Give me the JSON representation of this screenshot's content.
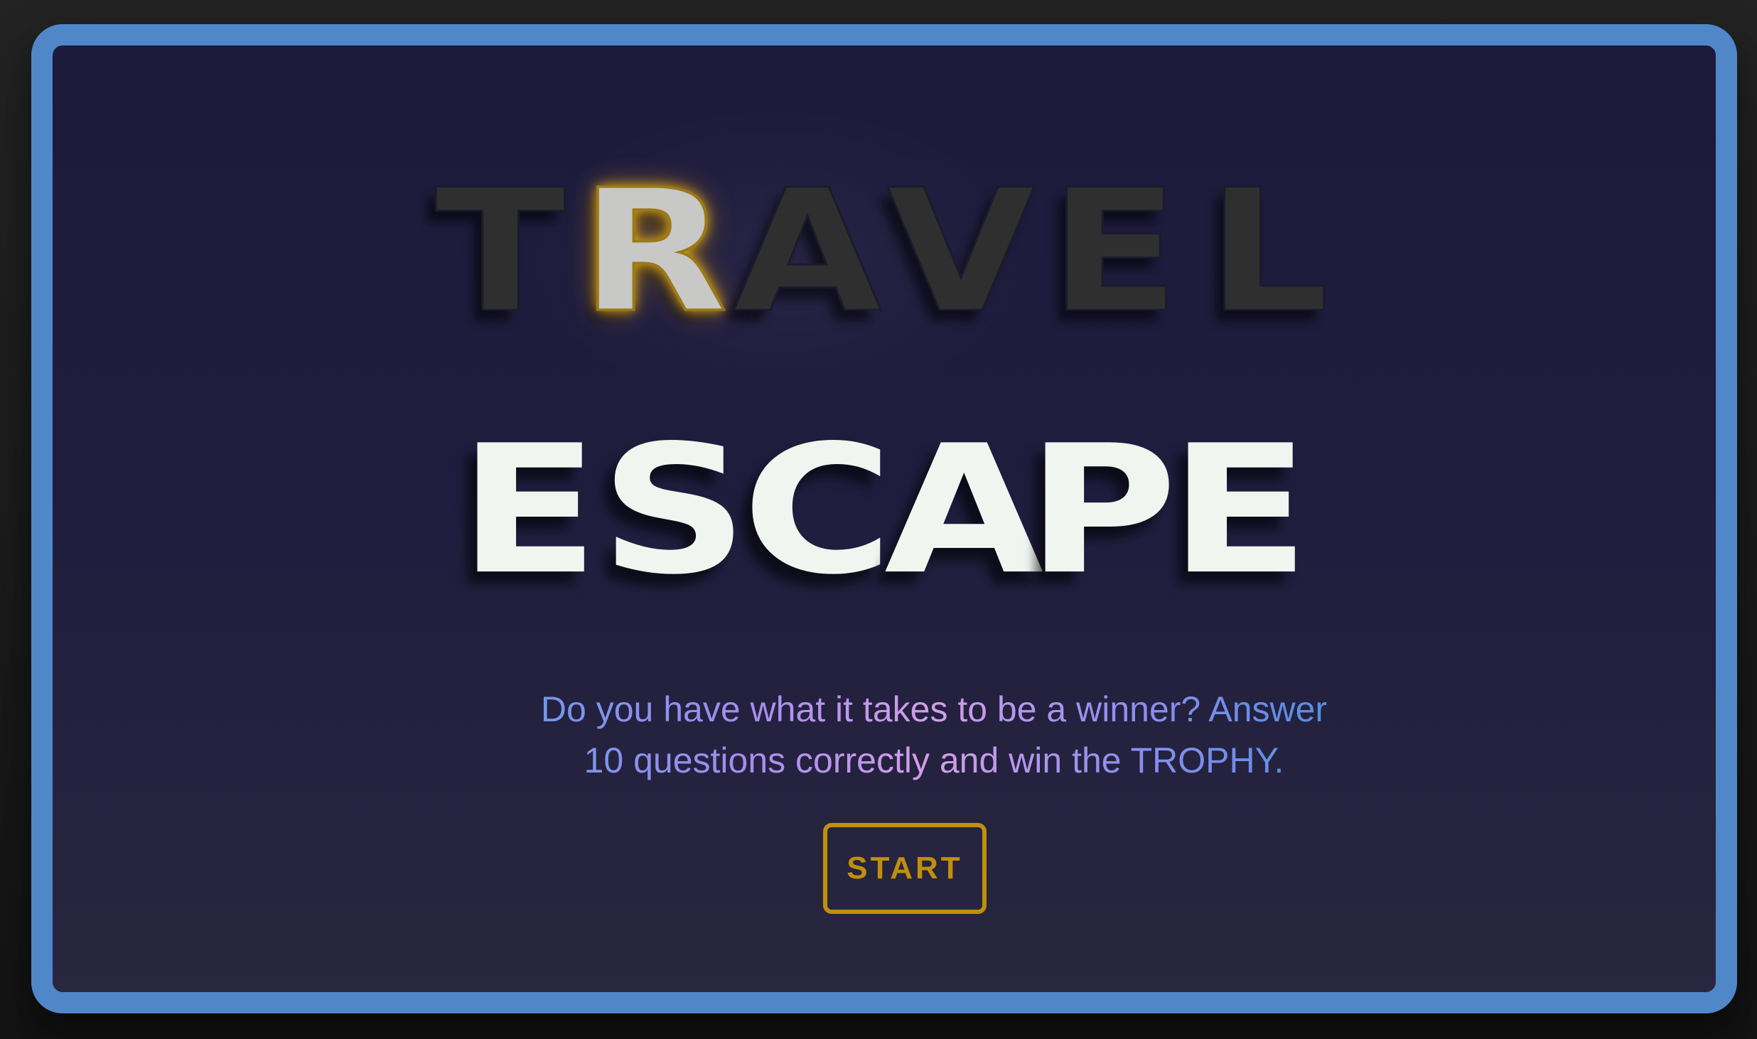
{
  "title": {
    "line1_letters": [
      "T",
      "R",
      "A",
      "V",
      "E",
      "L"
    ],
    "line1_lit_index": 1,
    "line2_letters": [
      "E",
      "S",
      "C",
      "A",
      "P",
      "E"
    ]
  },
  "tagline": {
    "line1": "Do you have what it takes to be a winner? Answer",
    "line2": "10 questions correctly and win the TROPHY."
  },
  "start_button": {
    "label": "START"
  },
  "colors": {
    "frame_border": "#4f87c8",
    "panel_background": "#1e1b3d",
    "lit_glow": "#ffbe14",
    "button_accent": "#c08f0c",
    "escape_text": "#f1f5f0",
    "travel_dim_text": "#2f2f30"
  }
}
